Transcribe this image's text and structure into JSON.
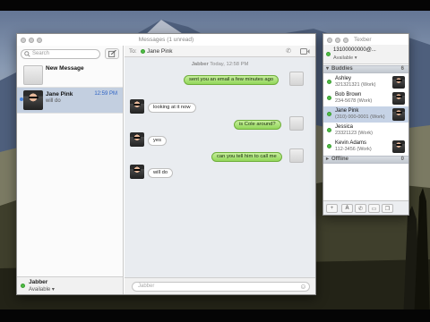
{
  "messages_window": {
    "title": "Messages (1 unread)",
    "search_placeholder": "Search",
    "to_label": "To:",
    "recipient": "Jane Pink",
    "conversations": [
      {
        "name": "New Message",
        "preview": "",
        "time": ""
      },
      {
        "name": "Jane Pink",
        "preview": "will do",
        "time": "12:59 PM"
      }
    ],
    "account": {
      "name": "Jabber",
      "status": "Available"
    },
    "timestamp": {
      "service": "Jabber",
      "date": "Today, 12:58 PM"
    },
    "messages": [
      {
        "from": "me",
        "text": "sent you an email a few minutes ago"
      },
      {
        "from": "them",
        "text": "looking at it now"
      },
      {
        "from": "me",
        "text": "is Cole around?"
      },
      {
        "from": "them",
        "text": "yes"
      },
      {
        "from": "me",
        "text": "can you tell him to call me"
      },
      {
        "from": "them",
        "text": "will do"
      }
    ],
    "input_placeholder": "Jabber"
  },
  "buddy_window": {
    "title": "Texber",
    "account_id": "13100000000@...",
    "account_status": "Available",
    "buddies_header": "Buddies",
    "buddies_count": "6",
    "buddies": [
      {
        "name": "Ashley",
        "number": "321321321 (Work)"
      },
      {
        "name": "Bob Brown",
        "number": "234-5678 (Work)"
      },
      {
        "name": "Jane Pink",
        "number": "(310) 000-0001 (Work)"
      },
      {
        "name": "Jessica",
        "number": "23321123 (Work)"
      },
      {
        "name": "Kevin Adams",
        "number": "112-3456 (Work)"
      }
    ],
    "offline_header": "Offline",
    "offline_count": "0"
  },
  "colors": {
    "accent": "#4b86de",
    "available": "#4fbd45",
    "outgoing_bubble": "#92d65a"
  }
}
